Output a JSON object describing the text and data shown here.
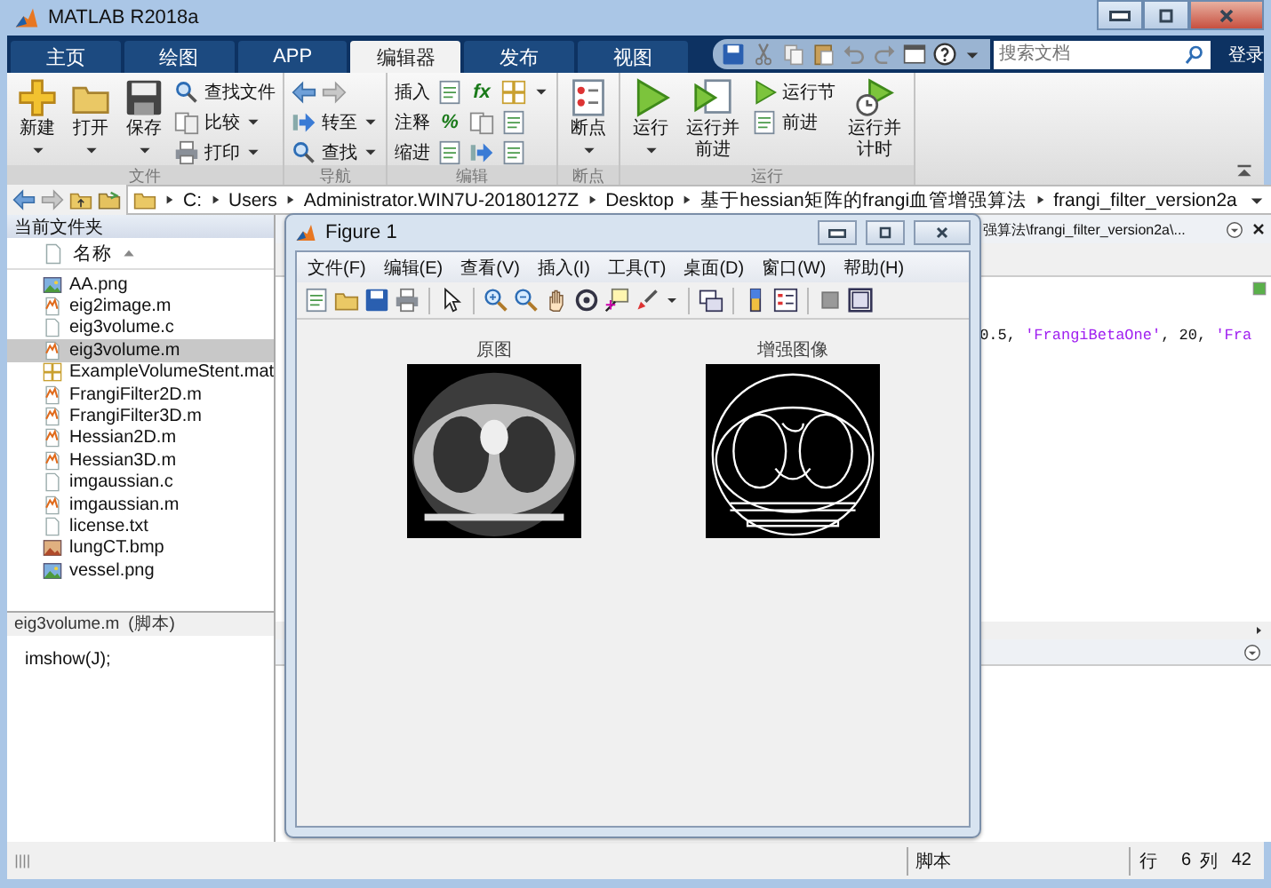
{
  "window": {
    "title": "MATLAB R2018a"
  },
  "tabs": [
    {
      "label": "主页",
      "selected": false
    },
    {
      "label": "绘图",
      "selected": false
    },
    {
      "label": "APP",
      "selected": false
    },
    {
      "label": "编辑器",
      "selected": true
    },
    {
      "label": "发布",
      "selected": false
    },
    {
      "label": "视图",
      "selected": false
    }
  ],
  "search": {
    "placeholder": "搜索文档"
  },
  "login": "登录",
  "ribbon": [
    {
      "label": "文件",
      "columns": [
        [
          {
            "kind": "large",
            "label": "新建",
            "dropdown": true
          }
        ],
        [
          {
            "kind": "large",
            "label": "打开",
            "dropdown": true
          }
        ],
        [
          {
            "kind": "large",
            "label": "保存",
            "dropdown": true
          }
        ],
        [
          {
            "kind": "small",
            "label": "查找文件",
            "dropdown": false
          },
          {
            "kind": "small",
            "label": "比较",
            "dropdown": true
          },
          {
            "kind": "small",
            "label": "打印",
            "dropdown": true
          }
        ]
      ]
    },
    {
      "label": "导航",
      "columns": [
        [
          {
            "kind": "arrows"
          },
          {
            "kind": "small",
            "label": "转至",
            "dropdown": true
          },
          {
            "kind": "small",
            "label": "查找",
            "dropdown": true
          }
        ]
      ]
    },
    {
      "label": "编辑",
      "columns": [
        [
          {
            "kind": "row",
            "label": "插入",
            "cells": [
              {
                "kind": "icon"
              },
              {
                "kind": "glyph",
                "text": "fx"
              },
              {
                "kind": "icon"
              },
              {
                "kind": "caret"
              }
            ]
          },
          {
            "kind": "row",
            "label": "注释",
            "cells": [
              {
                "kind": "glyph",
                "text": "%"
              },
              {
                "kind": "icon"
              },
              {
                "kind": "icon"
              }
            ]
          },
          {
            "kind": "row",
            "label": "缩进",
            "cells": [
              {
                "kind": "icon"
              },
              {
                "kind": "icon"
              },
              {
                "kind": "icon"
              }
            ]
          }
        ]
      ]
    },
    {
      "label": "断点",
      "columns": [
        [
          {
            "kind": "large",
            "label": "断点",
            "dropdown": true
          }
        ]
      ]
    },
    {
      "label": "运行",
      "columns": [
        [
          {
            "kind": "large",
            "label": "运行",
            "dropdown": true
          }
        ],
        [
          {
            "kind": "large",
            "label": "运行并前进",
            "dropdown": false
          }
        ],
        [
          {
            "kind": "small",
            "label": "运行节",
            "dropdown": false
          },
          {
            "kind": "small",
            "label": "前进",
            "dropdown": false
          }
        ],
        [
          {
            "kind": "large",
            "label": "运行并计时",
            "dropdown": false
          }
        ]
      ]
    }
  ],
  "path": [
    "C:",
    "Users",
    "Administrator.WIN7U-20180127Z",
    "Desktop",
    "基于hessian矩阵的frangi血管增强算法",
    "frangi_filter_version2a"
  ],
  "folder": {
    "title": "当前文件夹",
    "column": "名称",
    "files": [
      {
        "name": "AA.png",
        "kind": "image",
        "selected": false
      },
      {
        "name": "eig2image.m",
        "kind": "script",
        "selected": false
      },
      {
        "name": "eig3volume.c",
        "kind": "plain",
        "selected": false
      },
      {
        "name": "eig3volume.m",
        "kind": "script",
        "selected": true
      },
      {
        "name": "ExampleVolumeStent.mat",
        "kind": "data",
        "selected": false
      },
      {
        "name": "FrangiFilter2D.m",
        "kind": "script",
        "selected": false
      },
      {
        "name": "FrangiFilter3D.m",
        "kind": "script",
        "selected": false
      },
      {
        "name": "Hessian2D.m",
        "kind": "script",
        "selected": false
      },
      {
        "name": "Hessian3D.m",
        "kind": "script",
        "selected": false
      },
      {
        "name": "imgaussian.c",
        "kind": "plain",
        "selected": false
      },
      {
        "name": "imgaussian.m",
        "kind": "script",
        "selected": false
      },
      {
        "name": "license.txt",
        "kind": "plain",
        "selected": false
      },
      {
        "name": "lungCT.bmp",
        "kind": "bitmap",
        "selected": false
      },
      {
        "name": "vessel.png",
        "kind": "image",
        "selected": false
      }
    ],
    "details": {
      "name": "eig3volume.m",
      "type": "(脚本)"
    },
    "preview": "imshow(J);"
  },
  "editor": {
    "path": "强算法\\frangi_filter_version2a\\...",
    "code": [
      {
        "kind": "plain",
        "text": "0.5, "
      },
      {
        "kind": "string",
        "text": "'FrangiBetaOne'"
      },
      {
        "kind": "plain",
        "text": ", 20, "
      },
      {
        "kind": "string",
        "text": "'Fra"
      }
    ]
  },
  "figure": {
    "title": "Figure 1",
    "menu": [
      "文件(F)",
      "编辑(E)",
      "查看(V)",
      "插入(I)",
      "工具(T)",
      "桌面(D)",
      "窗口(W)",
      "帮助(H)"
    ],
    "axes": [
      {
        "title": "原图",
        "kind": "original"
      },
      {
        "title": "增强图像",
        "kind": "enhanced"
      }
    ]
  },
  "status": {
    "mode": "脚本",
    "line_label": "行",
    "line": "6",
    "col_label": "列",
    "col": "42"
  }
}
